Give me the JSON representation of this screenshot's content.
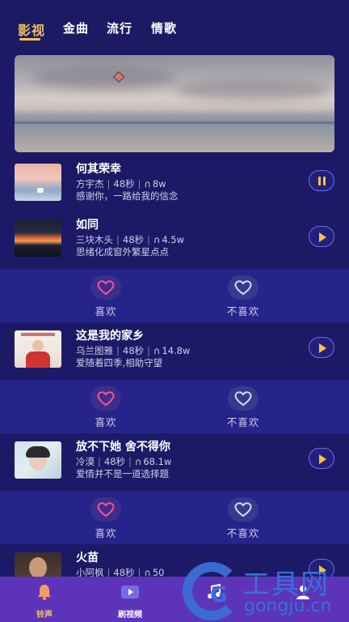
{
  "tabs": [
    "影视",
    "金曲",
    "流行",
    "情歌"
  ],
  "songs": [
    {
      "title": "何其荣幸",
      "artist": "方宇杰",
      "duration": "48秒",
      "plays": "8w",
      "desc": "感谢你，一路给我的信念",
      "state": "playing"
    },
    {
      "title": "如同",
      "artist": "三块木头",
      "duration": "48秒",
      "plays": "4.5w",
      "desc": "思绪化成窗外繁星点点",
      "state": "paused"
    },
    {
      "title": "这是我的家乡",
      "artist": "乌兰图雅",
      "duration": "48秒",
      "plays": "14.8w",
      "desc": "爱随着四季,相助守望",
      "state": "paused"
    },
    {
      "title": "放不下她 舍不得你",
      "artist": "冷漠",
      "duration": "48秒",
      "plays": "68.1w",
      "desc": "爱情并不是一道选择题",
      "state": "paused"
    },
    {
      "title": "火苗",
      "artist": "小阿枫",
      "duration": "48秒",
      "plays": "50",
      "desc": "",
      "state": "paused"
    }
  ],
  "reactions": {
    "like": "喜欢",
    "dislike": "不喜欢"
  },
  "nav": [
    {
      "label": "铃声",
      "icon": "bell-icon",
      "active": true
    },
    {
      "label": "刷视频",
      "icon": "video-icon",
      "active": false
    },
    {
      "label": "",
      "icon": "music-icon",
      "active": false
    },
    {
      "label": "",
      "icon": "user-icon",
      "active": false
    }
  ],
  "watermark": {
    "text": "工具网",
    "domain": "gongju.cn",
    "glyph": "G"
  },
  "colors": {
    "accent": "#f1c15a",
    "background": "#1c1a66",
    "reaction_bg": "#26248a",
    "nav_bg": "#5d34b9",
    "like": "#ff4f9a"
  }
}
